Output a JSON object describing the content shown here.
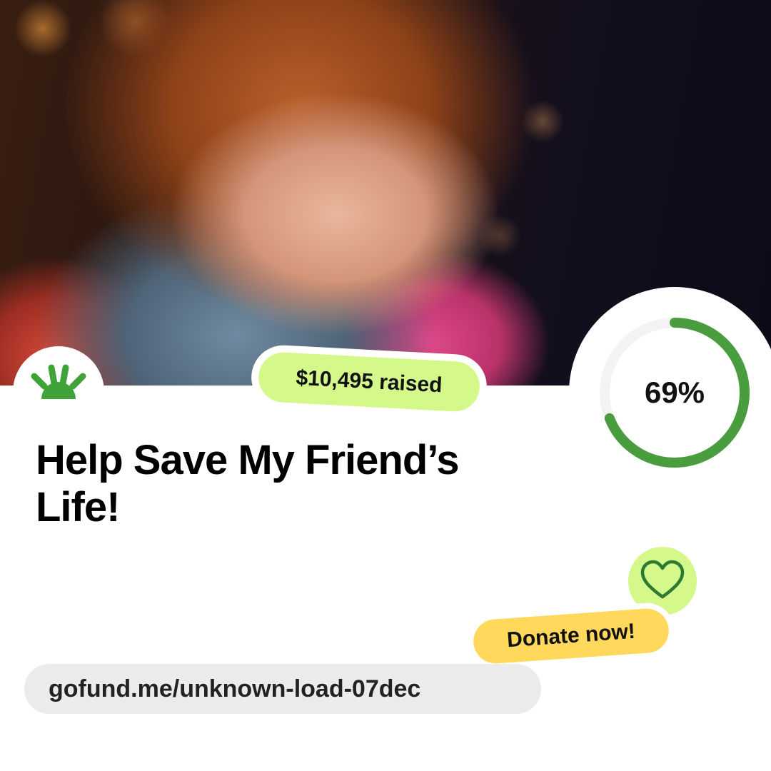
{
  "campaign": {
    "title": "Help Save My Friend’s Life!",
    "raised_label": "$10,495 raised",
    "progress_label": "69%",
    "progress_fraction": 0.69,
    "donate_label": "Donate now!",
    "url": "gofund.me/unknown-load-07dec"
  },
  "icons": {
    "logo": "gofundme-sunrise-icon",
    "heart": "heart-icon"
  },
  "colors": {
    "progress_arc": "#4a9d3f",
    "progress_track": "#f3f3f3",
    "logo_green": "#3fa33a",
    "raised_pill": "#d4f98a",
    "donate_pill": "#ffd85c",
    "heart_bg": "#d4f98a",
    "heart_stroke": "#2f7a30",
    "url_pill": "#ebebeb"
  }
}
